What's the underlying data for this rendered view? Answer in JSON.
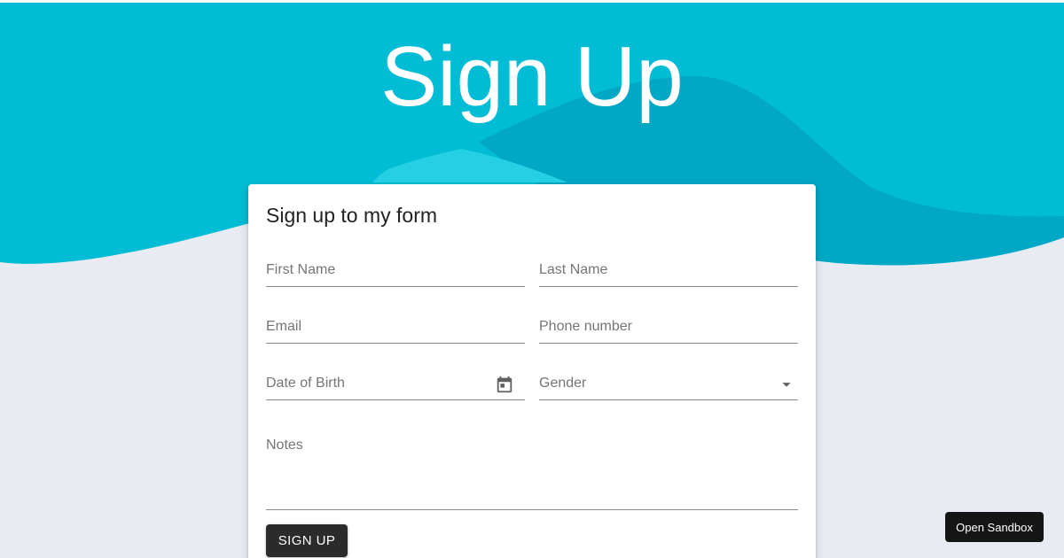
{
  "hero": {
    "title": "Sign Up"
  },
  "form": {
    "title": "Sign up to my form",
    "fields": {
      "first_name": {
        "label": "First Name",
        "value": ""
      },
      "last_name": {
        "label": "Last Name",
        "value": ""
      },
      "email": {
        "label": "Email",
        "value": ""
      },
      "phone": {
        "label": "Phone number",
        "value": ""
      },
      "date_of_birth": {
        "label": "Date of Birth",
        "value": "",
        "icon": "calendar-icon"
      },
      "gender": {
        "label": "Gender",
        "value": "",
        "icon": "dropdown-arrow-icon"
      },
      "notes": {
        "label": "Notes",
        "value": ""
      }
    },
    "submit_label": "SIGN UP"
  },
  "sandbox_button_label": "Open Sandbox",
  "colors": {
    "hero_primary": "#00bcd4",
    "hero_dark": "#00a8c6",
    "hero_light": "#26d0e4",
    "page_background": "#e9ebf3",
    "button_dark": "#2b2b2b"
  }
}
